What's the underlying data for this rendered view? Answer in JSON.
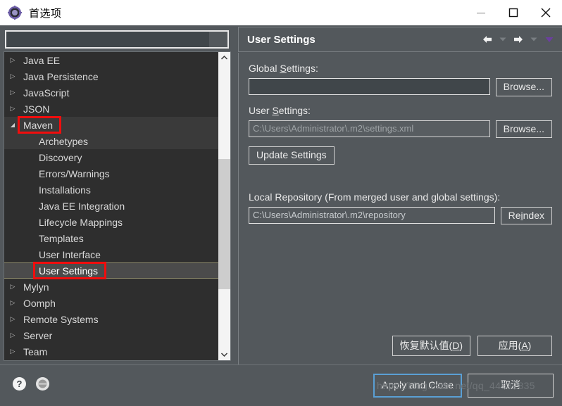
{
  "window": {
    "title": "首选项",
    "icon": "preferences-gear-icon",
    "controls": {
      "minimize": "minimize-icon",
      "maximize": "maximize-icon",
      "close": "close-icon"
    }
  },
  "search": {
    "value": "",
    "placeholder": ""
  },
  "tree": {
    "items": [
      {
        "label": "Java EE",
        "indent": 0,
        "state": "collapsed"
      },
      {
        "label": "Java Persistence",
        "indent": 0,
        "state": "collapsed"
      },
      {
        "label": "JavaScript",
        "indent": 0,
        "state": "collapsed"
      },
      {
        "label": "JSON",
        "indent": 0,
        "state": "collapsed"
      },
      {
        "label": "Maven",
        "indent": 0,
        "state": "expanded",
        "annotated": true,
        "band": true
      },
      {
        "label": "Archetypes",
        "indent": 1,
        "state": "leaf",
        "band": true
      },
      {
        "label": "Discovery",
        "indent": 1,
        "state": "leaf"
      },
      {
        "label": "Errors/Warnings",
        "indent": 1,
        "state": "leaf"
      },
      {
        "label": "Installations",
        "indent": 1,
        "state": "leaf"
      },
      {
        "label": "Java EE Integration",
        "indent": 1,
        "state": "leaf"
      },
      {
        "label": "Lifecycle Mappings",
        "indent": 1,
        "state": "leaf"
      },
      {
        "label": "Templates",
        "indent": 1,
        "state": "leaf"
      },
      {
        "label": "User Interface",
        "indent": 1,
        "state": "leaf"
      },
      {
        "label": "User Settings",
        "indent": 1,
        "state": "leaf",
        "selected": true,
        "annotated": true
      },
      {
        "label": "Mylyn",
        "indent": 0,
        "state": "collapsed"
      },
      {
        "label": "Oomph",
        "indent": 0,
        "state": "collapsed"
      },
      {
        "label": "Remote Systems",
        "indent": 0,
        "state": "collapsed"
      },
      {
        "label": "Server",
        "indent": 0,
        "state": "collapsed"
      },
      {
        "label": "Team",
        "indent": 0,
        "state": "collapsed"
      }
    ],
    "scrollbar": {
      "up": "chevron-up-icon",
      "down": "chevron-down-icon"
    }
  },
  "panel": {
    "title": "User Settings",
    "nav": {
      "back": "arrow-left-icon",
      "back_menu": "chevron-down-icon",
      "forward": "arrow-right-icon",
      "forward_menu": "chevron-down-icon",
      "view_menu": "chevron-down-icon"
    },
    "global_settings": {
      "label_pre": "Global ",
      "label_mnemonic": "S",
      "label_post": "ettings:",
      "value": "",
      "placeholder": "",
      "browse_label": "Browse..."
    },
    "user_settings": {
      "label_pre": "User ",
      "label_mnemonic": "S",
      "label_post": "ettings:",
      "value": "C:\\Users\\Administrator\\.m2\\settings.xml",
      "browse_label": "Browse...",
      "update_label": "Update Settings"
    },
    "local_repository": {
      "label": "Local Repository (From merged user and global settings):",
      "value": "C:\\Users\\Administrator\\.m2\\repository",
      "reindex_pre": "Re",
      "reindex_mnemonic": "i",
      "reindex_post": "ndex"
    },
    "footer": {
      "restore_pre": "恢复默认值(",
      "restore_mnemonic": "D",
      "restore_post": ")",
      "apply_pre": "应用(",
      "apply_mnemonic": "A",
      "apply_post": ")"
    }
  },
  "bottom": {
    "help_icon": "help-circle-icon",
    "status_icon": "toggle-circle-icon",
    "apply_and_close": "Apply and Close",
    "cancel": "取消",
    "watermark": "https://blog.csdn.net/qq_44932835"
  },
  "colors": {
    "panel_bg": "#53585c",
    "tree_bg": "#2e2e2e",
    "annotation": "#f10d0d",
    "focus": "#5a9fd4",
    "accent_purple": "#6b3f9e"
  }
}
